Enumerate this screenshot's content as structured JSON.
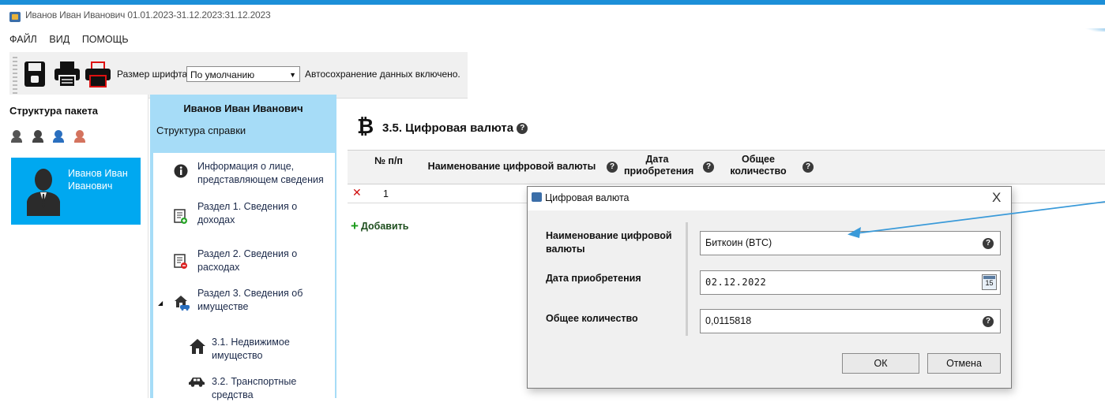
{
  "window": {
    "title": "Иванов Иван Иванович 01.01.2023-31.12.2023:31.12.2023"
  },
  "menu": [
    "ФАЙЛ",
    "ВИД",
    "ПОМОЩЬ"
  ],
  "toolbar": {
    "font_size_label": "Размер шрифта:",
    "font_size_value": "По умолчанию",
    "autosave_text": "Автосохранение данных включено.",
    "buttons": [
      "save-icon",
      "print-icon",
      "print-red-icon"
    ]
  },
  "package": {
    "title": "Структура пакета",
    "person_icons": [
      "add-person-icon",
      "add-person-icon",
      "add-person-icon",
      "add-person-icon"
    ],
    "person_name": "Иванов Иван Иванович"
  },
  "structure": {
    "header_name": "Иванов Иван Иванович",
    "subtitle": "Структура справки",
    "items": [
      {
        "label": "Информация о лице, представляющем сведения",
        "icon": "info-icon"
      },
      {
        "label": "Раздел 1. Сведения о доходах",
        "icon": "income-doc-icon"
      },
      {
        "label": "Раздел 2. Сведения о расходах",
        "icon": "expense-doc-icon"
      },
      {
        "label": "Раздел 3. Сведения об имуществе",
        "icon": "property-icon"
      },
      {
        "label": "3.1. Недвижимое имущество",
        "icon": "house-icon"
      },
      {
        "label": "3.2. Транспортные средства",
        "icon": "car-icon"
      }
    ]
  },
  "main": {
    "section_title": "3.5. Цифровая валюта",
    "columns": [
      "№ п/п",
      "Наименование цифровой валюты",
      "Дата приобретения",
      "Общее количество"
    ],
    "rows": [
      {
        "num": "1",
        "name": "",
        "date": "",
        "amount": ""
      }
    ],
    "add_label": "Добавить"
  },
  "dialog": {
    "title": "Цифровая валюта",
    "close": "X",
    "fields": [
      {
        "label": "Наименование цифровой валюты",
        "value": "Биткоин (BTC)"
      },
      {
        "label": "Дата приобретения",
        "value": "02.12.2022",
        "calendar_day": "15"
      },
      {
        "label": "Общее количество",
        "value": "0,0115818"
      }
    ],
    "ok_label": "ОК",
    "cancel_label": "Отмена"
  },
  "colors": {
    "accent": "#1c8fd8",
    "panel_blue": "#a6dcf7",
    "selected_card": "#00a8f0",
    "delete_red": "#d01010",
    "add_green": "#1a9a1a"
  }
}
